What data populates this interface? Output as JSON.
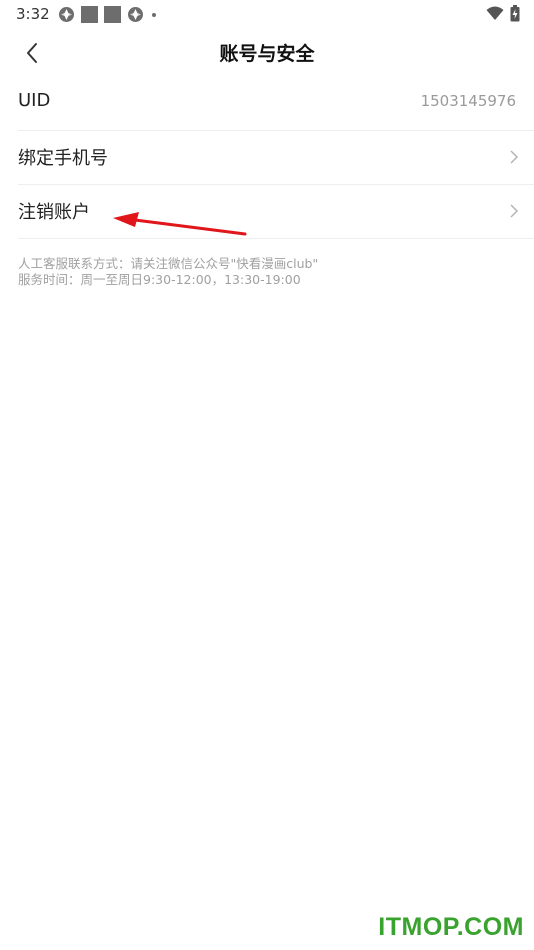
{
  "status_bar": {
    "time": "3:32",
    "left_icons": [
      "app-icon",
      "square-icon",
      "square-icon",
      "app-icon",
      "dot-icon"
    ],
    "right_icons": [
      "wifi-icon",
      "battery-icon"
    ]
  },
  "header": {
    "title": "账号与安全",
    "back_icon": "chevron-left-icon"
  },
  "rows": [
    {
      "label": "UID",
      "value": "1503145976"
    },
    {
      "label": "绑定手机号",
      "icon": "chevron-right-icon"
    },
    {
      "label": "注销账户",
      "icon": "chevron-right-icon"
    }
  ],
  "note": {
    "line1": "人工客服联系方式：请关注微信公众号\"快看漫画club\"",
    "line2": "服务时间：周一至周日9:30-12:00，13:30-19:00"
  },
  "annotation": {
    "arrow_color": "#e0161b"
  },
  "watermark": {
    "text": "ITMOP.COM",
    "color": "#3aa22e"
  }
}
